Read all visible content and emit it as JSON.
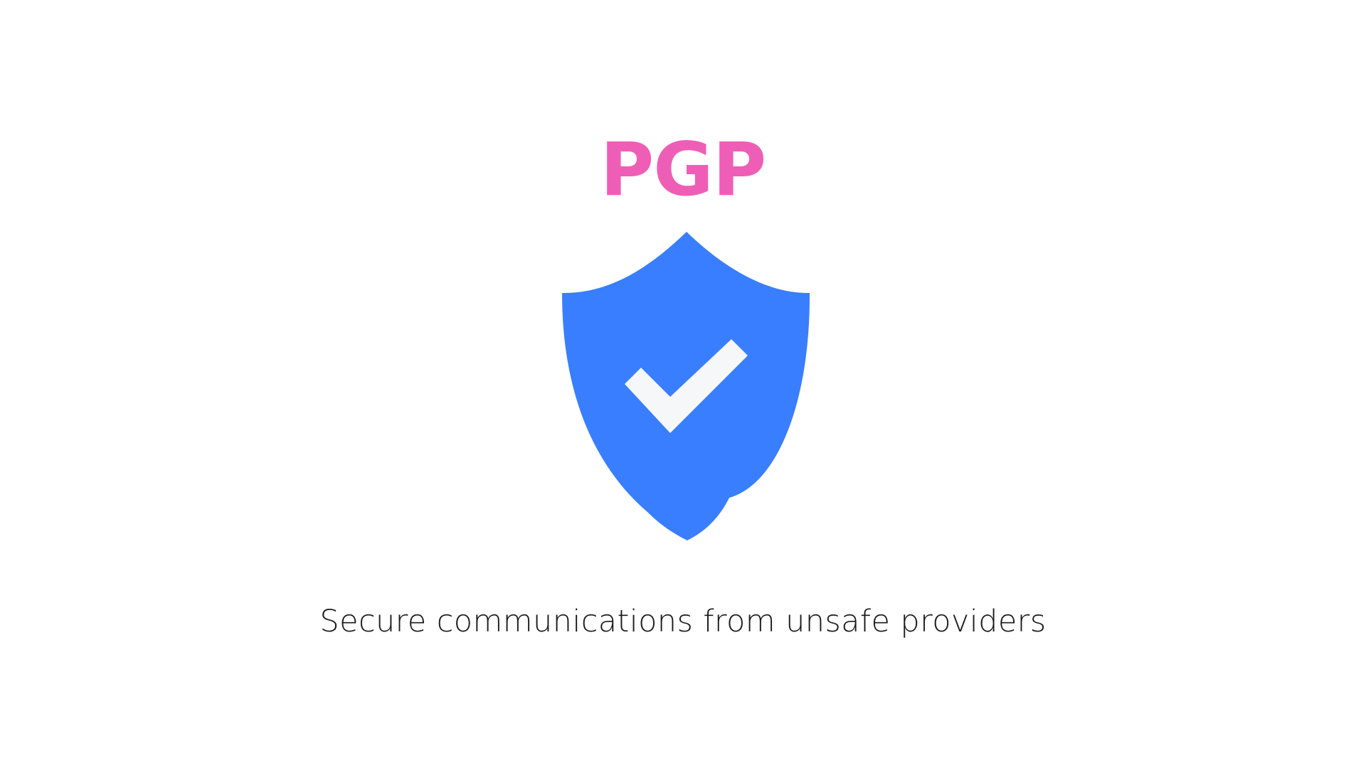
{
  "headline": "PGP",
  "tagline": "Secure communications from unsafe providers",
  "icons": {
    "shield": "shield-check-icon",
    "check": "checkmark-icon"
  },
  "colors": {
    "background": "#ffffff",
    "headline": "#ef5eb6",
    "shield": "#387eff",
    "check": "#f6f7f9",
    "tagline": "#1a1a1a"
  }
}
